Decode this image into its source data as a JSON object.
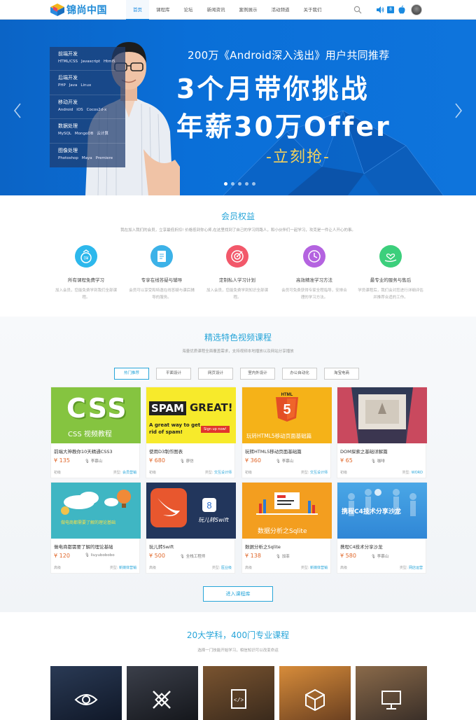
{
  "header": {
    "logo_text": "锦尚中国",
    "nav": [
      "首页",
      "课程库",
      "论坛",
      "新闻资讯",
      "案例展示",
      "活动频道",
      "关于我们"
    ],
    "active_nav": "首页",
    "badge": "8"
  },
  "banner": {
    "subtitle": "200万《Android深入浅出》用户共同推荐",
    "title_line1": "3个月带你挑战",
    "title_line2": "年薪30万Offer",
    "cta": "-立刻抢-",
    "categories": [
      {
        "title": "前端开发",
        "items": [
          "HTML/CSS",
          "Javascript",
          "Html5"
        ]
      },
      {
        "title": "后端开发",
        "items": [
          "PHP",
          "Java",
          "Linux"
        ]
      },
      {
        "title": "移动开发",
        "items": [
          "Android",
          "iOS",
          "Cocos2d-x"
        ]
      },
      {
        "title": "数据处理",
        "items": [
          "MySQL",
          "MongoDB",
          "云计算"
        ]
      },
      {
        "title": "图像处理",
        "items": [
          "Photoshop",
          "Maya",
          "Premiere"
        ]
      }
    ]
  },
  "member": {
    "title": "会员权益",
    "desc": "我在加入我们的会员，立享最低折扣! 价格低到你心疼,在这里找到了自己的学习同路人，和小伙伴们一起学习，攻克是一件让人开心的事。",
    "benefits": [
      {
        "name": "所有课程免费学习",
        "desc": "加入会员，您能免费学到我们全部课程。",
        "color": "#2db8ec",
        "icon": "coin-icon"
      },
      {
        "name": "专享在线答疑与辅导",
        "desc": "会员可以享受和特邀在线答疑与课后辅导的服务。",
        "color": "#3cb2e8",
        "icon": "document-icon"
      },
      {
        "name": "定制私人学习计划",
        "desc": "加入会员，您能免费学到知识全部课程。",
        "color": "#f2586a",
        "icon": "target-icon"
      },
      {
        "name": "高效精准学习方法",
        "desc": "会员可免费获得专家全程指导，安排合理的学习方法。",
        "color": "#b463e0",
        "icon": "clock-icon"
      },
      {
        "name": "最专业的服务与售后",
        "desc": "学员课程后，我们会对您进行详细评估并推荐合适的工作。",
        "color": "#3ccf7c",
        "icon": "heart-hand-icon"
      }
    ]
  },
  "courses": {
    "title": "精选特色视频课程",
    "desc": "海量优质课程全面覆盖需求，支持视频本地播放以及网站分享播放",
    "tabs": [
      "热门推荐",
      "平面设计",
      "网页设计",
      "室内外设计",
      "办公自动化",
      "淘宝电商"
    ],
    "items": [
      {
        "title": "前端大神教你10天精通CSS3",
        "price": "¥ 135",
        "teacher": "李慕山",
        "level": "初级",
        "type_label": "类型:",
        "type": "会员营销"
      },
      {
        "title": "使用D3制作图表",
        "price": "¥ 680",
        "teacher": "廖仿",
        "level": "初级",
        "type_label": "类型:",
        "type": "交互设计师"
      },
      {
        "title": "玩转HTML5移动页面基础篇",
        "price": "¥ 360",
        "teacher": "李慕山",
        "level": "初级",
        "type_label": "类型:",
        "type": "交互设计师"
      },
      {
        "title": "DOM探索之基础详解篇",
        "price": "¥ 65",
        "teacher": "咖啡",
        "level": "初级",
        "type_label": "类型:",
        "type": "WORD"
      },
      {
        "title": "做电商都需要了解的理论基础",
        "price": "¥ 120",
        "teacher": "liuyubobobo",
        "level": "高级",
        "type_label": "类型:",
        "type": "新媒体营销"
      },
      {
        "title": "玩儿转Swift",
        "price": "¥ 500",
        "teacher": "全栈工程师",
        "level": "高级",
        "type_label": "类型:",
        "type": "医业级"
      },
      {
        "title": "数据分析之Sqlite",
        "price": "¥ 138",
        "teacher": "加菲",
        "level": "高级",
        "type_label": "类型:",
        "type": "新媒体营销"
      },
      {
        "title": "携程C4技术分享沙龙",
        "price": "¥ 580",
        "teacher": "李慕山",
        "level": "高级",
        "type_label": "类型:",
        "type": "网店运营"
      }
    ],
    "thumbs": {
      "css_main": "CSS",
      "css_sub": "CSS 视频教程",
      "spam1": "SPAM",
      "spam2": "GREAT!",
      "spam3": "A great way to get",
      "spam4": "rid of spam!",
      "spam5": "Sign up now!",
      "html5": "HTML",
      "html5_num": "5",
      "html5_cap": "玩转HTML5移动页面基础篇",
      "ecom_cap": "做电商都需要了解的理论基础",
      "swift_cap": "玩儿转Swift",
      "swift_num": "8",
      "sqlite_cap": "数据分析之Sqlite",
      "c4_cap": "携程C4技术分享沙龙"
    },
    "enter_label": "进入课程库"
  },
  "subjects": {
    "title": "20大学科，400门专业课程",
    "desc": "选择一门技能开始学习，相信知识可以改变命运",
    "items": [
      {
        "icon": "eye-icon"
      },
      {
        "icon": "design-tools-icon"
      },
      {
        "icon": "code-file-icon"
      },
      {
        "icon": "cube-icon"
      },
      {
        "icon": "monitor-icon"
      }
    ]
  }
}
